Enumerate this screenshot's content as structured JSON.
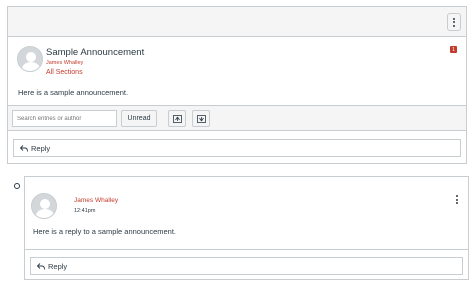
{
  "topic": {
    "title": "Sample Announcement",
    "author": "James Whalley",
    "sections": "All Sections",
    "unread_count": "1",
    "message": "Here is a sample announcement.",
    "reply_label": "Reply"
  },
  "filters": {
    "search_placeholder": "Search entries or author",
    "unread_label": "Unread",
    "expand_icon": "expand-threads-icon",
    "collapse_icon": "collapse-threads-icon"
  },
  "entry": {
    "author": "James Whalley",
    "timestamp": "12:41pm",
    "message": "Here is a reply to a sample announcement.",
    "reply_label": "Reply"
  },
  "colors": {
    "accent": "#c23c2d",
    "border": "#c7cdd1",
    "toolbar_bg": "#f5f5f5",
    "text": "#2d3b45"
  }
}
